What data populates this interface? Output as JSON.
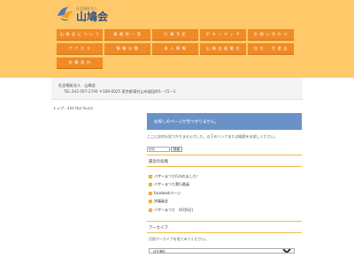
{
  "header": {
    "logo_sub": "社会福祉法人",
    "logo_main": "山鳩会",
    "logo_icon": "dove-icon",
    "nav": [
      {
        "label": "山 鳩 会 に つ い て"
      },
      {
        "label": "事 業 所 一 覧"
      },
      {
        "label": "行 事 予 定"
      },
      {
        "label": "ボ ラ ン テ ィ ア"
      },
      {
        "label": "お 問 い 合 わ せ"
      },
      {
        "label": "ア ク セ ス"
      },
      {
        "label": "情 報 公 開"
      },
      {
        "label": "求 人 情 報"
      },
      {
        "label": "山 鳩 会 後 援 会"
      },
      {
        "label": "自 主 ・ 生 産 品"
      },
      {
        "label": "診 療 案 内"
      }
    ]
  },
  "org": {
    "name": "社会福祉法人　山鳩会",
    "contact": "TEL.042-597-2700 〒189-0025 東京都東村山市廻田町1－15－1"
  },
  "breadcrumb": {
    "home": "トップ",
    "sep": "›",
    "current": "404 Not found"
  },
  "notfound": {
    "title": "お探しのページが見つかりません。",
    "message": "ここには何も見つかりませんでした。以下のリンクまたは検索をお試しください。"
  },
  "search": {
    "placeholder": "検索",
    "button": "検索"
  },
  "recent": {
    "heading": "最近の投稿",
    "items": [
      {
        "text": "バザーまつり行われました！"
      },
      {
        "text": "バザーまつり実行委員"
      },
      {
        "text": "facebookページ"
      },
      {
        "text": "評議員会"
      },
      {
        "text": "バザーまつり　(6月6日)"
      }
    ]
  },
  "archive": {
    "heading": "アーカイブ",
    "description": "月別アーカイブを見てみてください。",
    "select_value": "月を選択"
  },
  "colors": {
    "header_bg": "#ffc96a",
    "nav_button": "#f08a24",
    "notfound_bg": "#6b92c8",
    "rule": "#f2b84a",
    "bullet": "#f5a623"
  }
}
